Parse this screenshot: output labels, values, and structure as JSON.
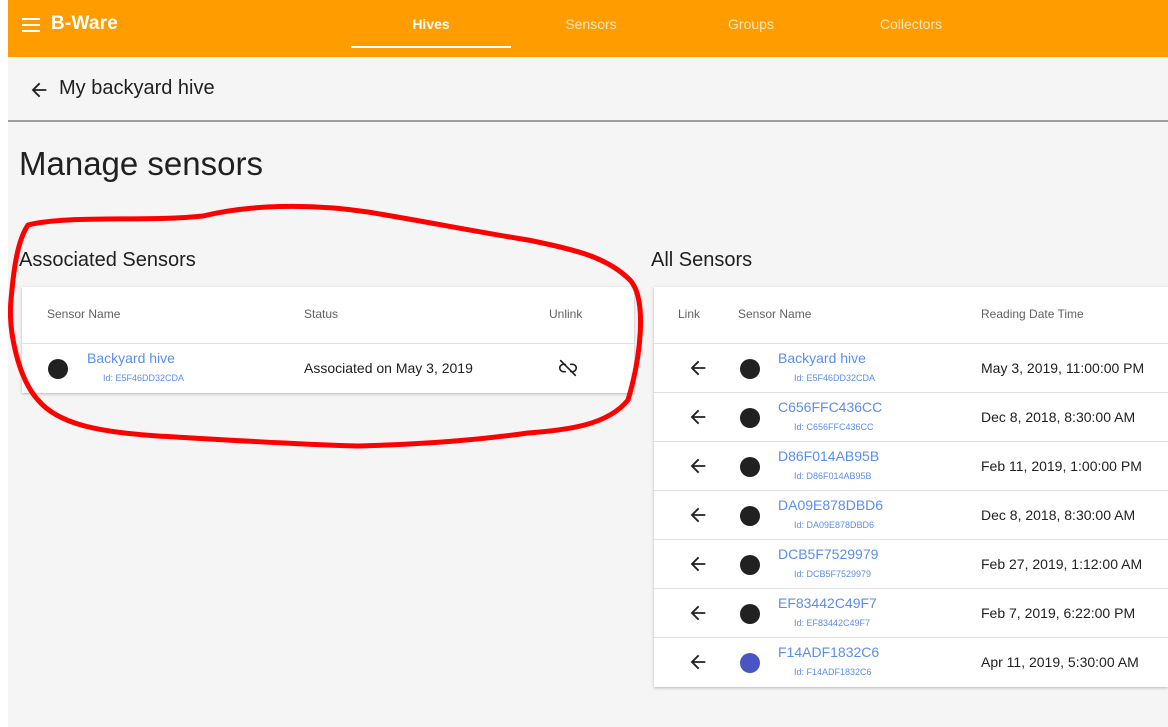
{
  "app": {
    "brand": "B-Ware",
    "tabs": [
      {
        "label": "Hives",
        "active": true
      },
      {
        "label": "Sensors",
        "active": false
      },
      {
        "label": "Groups",
        "active": false
      },
      {
        "label": "Collectors",
        "active": false
      }
    ],
    "accent_color": "#ff9d00"
  },
  "subheader": {
    "title": "My backyard hive"
  },
  "page": {
    "title": "Manage sensors"
  },
  "associated": {
    "title": "Associated Sensors",
    "headers": {
      "name": "Sensor Name",
      "status": "Status",
      "unlink": "Unlink"
    },
    "rows": [
      {
        "name": "Backyard hive",
        "id": "Id: E5F46DD32CDA",
        "status": "Associated on May 3, 2019",
        "dot_color": "#212121"
      }
    ]
  },
  "all": {
    "title": "All Sensors",
    "headers": {
      "link": "Link",
      "name": "Sensor Name",
      "date": "Reading Date Time"
    },
    "rows": [
      {
        "name": "Backyard hive",
        "id": "Id: E5F46DD32CDA",
        "date": "May 3, 2019, 11:00:00 PM",
        "dot_color": "#212121"
      },
      {
        "name": "C656FFC436CC",
        "id": "Id: C656FFC436CC",
        "date": "Dec 8, 2018, 8:30:00 AM",
        "dot_color": "#212121"
      },
      {
        "name": "D86F014AB95B",
        "id": "Id: D86F014AB95B",
        "date": "Feb 11, 2019, 1:00:00 PM",
        "dot_color": "#212121"
      },
      {
        "name": "DA09E878DBD6",
        "id": "Id: DA09E878DBD6",
        "date": "Dec 8, 2018, 8:30:00 AM",
        "dot_color": "#212121"
      },
      {
        "name": "DCB5F7529979",
        "id": "Id: DCB5F7529979",
        "date": "Feb 27, 2019, 1:12:00 AM",
        "dot_color": "#212121"
      },
      {
        "name": "EF83442C49F7",
        "id": "Id: EF83442C49F7",
        "date": "Feb 7, 2019, 6:22:00 PM",
        "dot_color": "#212121"
      },
      {
        "name": "F14ADF1832C6",
        "id": "Id: F14ADF1832C6",
        "date": "Apr 11, 2019, 5:30:00 AM",
        "dot_color": "#4a55c4"
      }
    ]
  },
  "icons": {
    "menu": "menu-icon",
    "back": "arrow-left-icon",
    "unlink": "link-off-icon",
    "link": "arrow-left-icon"
  },
  "annotation": {
    "shape": "freehand-circle",
    "color": "#ff0000"
  }
}
